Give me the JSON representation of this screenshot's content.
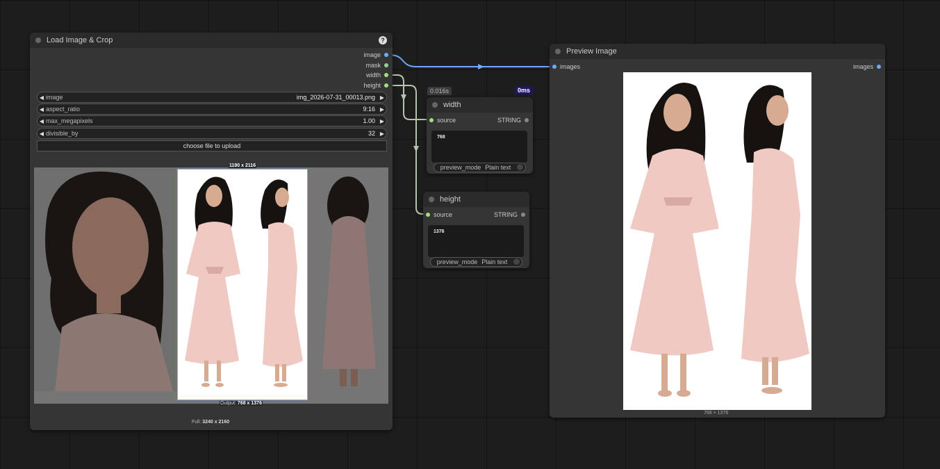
{
  "load_node": {
    "title": "Load Image & Crop",
    "help": "?",
    "outputs": [
      {
        "label": "image",
        "color": "#6ea8ff"
      },
      {
        "label": "mask",
        "color": "#8fd18f"
      },
      {
        "label": "width",
        "color": "#a3e07a"
      },
      {
        "label": "height",
        "color": "#a3e07a"
      }
    ],
    "widgets": [
      {
        "label": "image",
        "value": "img_2026-07-31_00013.png"
      },
      {
        "label": "aspect_ratio",
        "value": "9:16"
      },
      {
        "label": "max_megapixels",
        "value": "1.00"
      },
      {
        "label": "divisible_by",
        "value": "32"
      }
    ],
    "upload_label": "choose file to upload",
    "crop_size_label": "1190 x 2116",
    "output_prefix": "Output:",
    "output_size": "768 x 1376",
    "full_prefix": "Full:",
    "full_size": "3240 x 2160"
  },
  "width_node": {
    "timing": "0.016s",
    "exec_badge": "0ms",
    "title": "width",
    "input_label": "source",
    "output_label": "STRING",
    "value": "768",
    "toggle_label": "preview_mode",
    "toggle_value": "Plain text"
  },
  "height_node": {
    "title": "height",
    "input_label": "source",
    "output_label": "STRING",
    "value": "1376",
    "toggle_label": "preview_mode",
    "toggle_value": "Plain text"
  },
  "preview_node": {
    "title": "Preview Image",
    "input_label": "images",
    "output_label": "images",
    "size_label": "768 × 1376"
  },
  "colors": {
    "image_link": "#6ea8ff",
    "int_link": "#b8c4b0",
    "exec_badge_bg": "#1f1660"
  }
}
